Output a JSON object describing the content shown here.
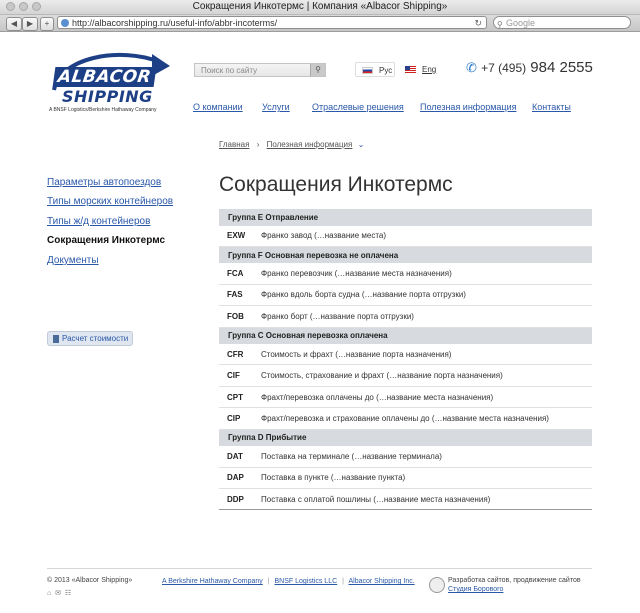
{
  "window": {
    "title": "Сокращения Инкотермс | Компания «Albacor Shipping»"
  },
  "toolbar": {
    "url": "http://albacorshipping.ru/useful-info/abbr-incoterms/",
    "search_placeholder": "Google",
    "back": "◀",
    "forward": "▶",
    "add": "+",
    "refresh": "↻"
  },
  "header": {
    "logo_line1": "ALBACOR",
    "logo_line2": "SHIPPING",
    "logo_sub": "A BNSF Logistics/Berkshire Hathaway Company",
    "search_placeholder": "Поиск по сайту",
    "lang_ru": "Рус",
    "lang_en": "Eng",
    "phone_code": "+7 (495)",
    "phone_number": "984 2555"
  },
  "menu": [
    "О компании",
    "Услуги",
    "Отраслевые решения",
    "Полезная информация",
    "Контакты"
  ],
  "breadcrumb": {
    "home": "Главная",
    "sep": "›",
    "current": "Полезная информация",
    "caret": "⌄"
  },
  "sidebar": {
    "items": [
      "Параметры автопоездов",
      "Типы морских контейнеров",
      "Типы ж/д контейнеров",
      "Сокращения Инкотермс",
      "Документы"
    ],
    "active_index": 3,
    "calc_label": "Расчет стоимости"
  },
  "main": {
    "title": "Сокращения Инкотермс",
    "groups": [
      {
        "name": "Группа E Отправление",
        "rows": [
          {
            "code": "EXW",
            "text": "Франко завод (…название места)"
          }
        ]
      },
      {
        "name": "Группа F Основная перевозка не оплачена",
        "rows": [
          {
            "code": "FCA",
            "text": "Франко перевозчик (…название места назначения)"
          },
          {
            "code": "FAS",
            "text": "Франко вдоль борта судна (…название порта отгрузки)"
          },
          {
            "code": "FOB",
            "text": "Франко борт (…название порта отгрузки)"
          }
        ]
      },
      {
        "name": "Группа C Основная перевозка оплачена",
        "rows": [
          {
            "code": "CFR",
            "text": "Стоимость и фрахт (…название порта назначения)"
          },
          {
            "code": "CIF",
            "text": "Стоимость, страхование и фрахт (…название порта назначения)"
          },
          {
            "code": "CPT",
            "text": "Фрахт/перевозка оплачены до (…название места назначения)"
          },
          {
            "code": "CIP",
            "text": "Фрахт/перевозка и страхование оплачены до (…название места назначения)"
          }
        ]
      },
      {
        "name": "Группа D Прибытие",
        "rows": [
          {
            "code": "DAT",
            "text": "Поставка на терминале (…название терминала)"
          },
          {
            "code": "DAP",
            "text": "Поставка в пункте (…название пункта)"
          },
          {
            "code": "DDP",
            "text": "Поставка с оплатой пошлины (…название места назначения)"
          }
        ]
      }
    ]
  },
  "footer": {
    "copyright": "© 2013 «Albacor Shipping»",
    "links": [
      "A Berkshire Hathaway Company",
      "BNSF Logistics LLC",
      "Albacor Shipping Inc."
    ],
    "studio_text": "Разработка сайтов, продвижение сайтов",
    "studio_link": "Студия Борового"
  },
  "colors": {
    "link": "#2a58a8",
    "brand": "#1d3f86",
    "group_bg": "#d7dadf"
  }
}
